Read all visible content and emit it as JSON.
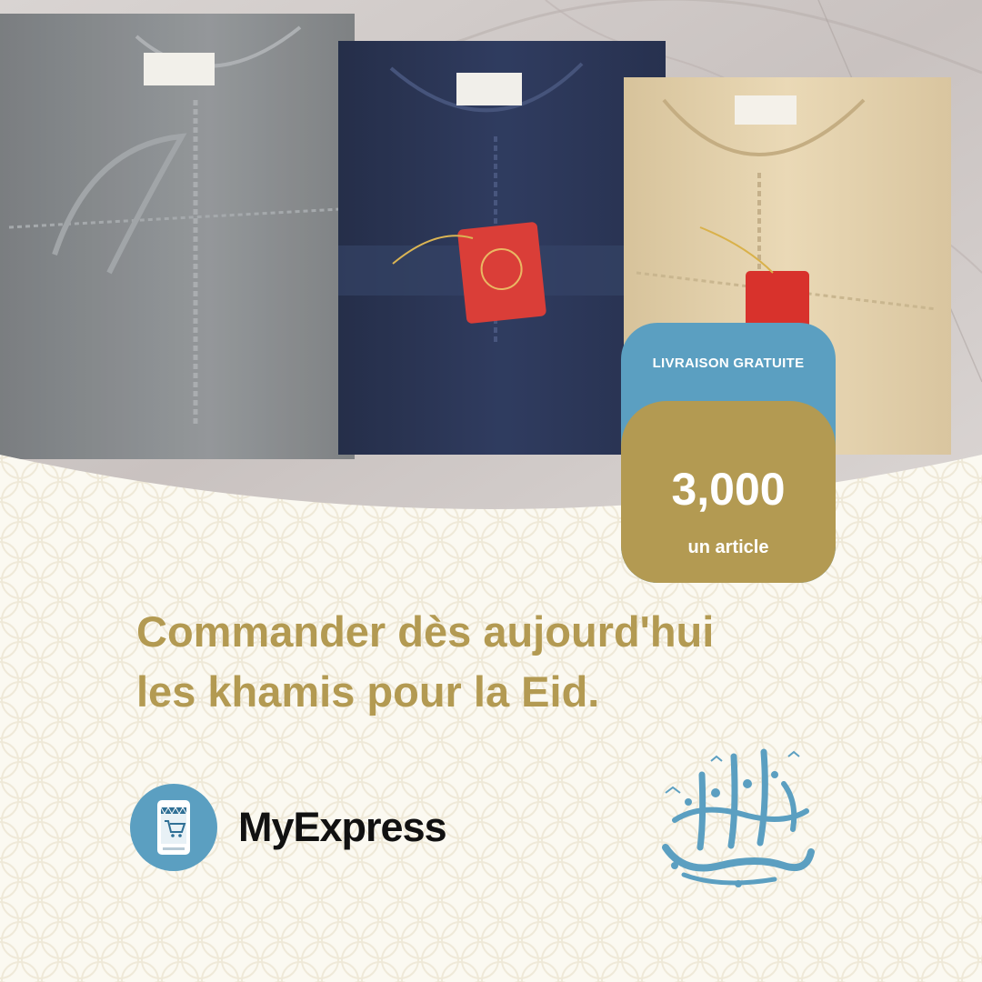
{
  "badge": {
    "top_label": "LIVRAISON GRATUITE",
    "price": "3,000",
    "unit": "un article"
  },
  "headline": {
    "line1": "Commander dès aujourd'hui",
    "line2": "les khamis pour la Eid."
  },
  "brand": {
    "name": "MyExpress",
    "logo_icon": "shopping-cart-phone-icon"
  },
  "decor": {
    "calligraphy": "eid-mubarak-calligraphy"
  },
  "colors": {
    "gold": "#b39a52",
    "blue": "#5b9fc1",
    "background": "#fbf9f1",
    "garment_grey": "#7d8184",
    "garment_navy": "#1d2a4c",
    "garment_beige": "#e2cfa8",
    "tag_red": "#d8322c"
  }
}
